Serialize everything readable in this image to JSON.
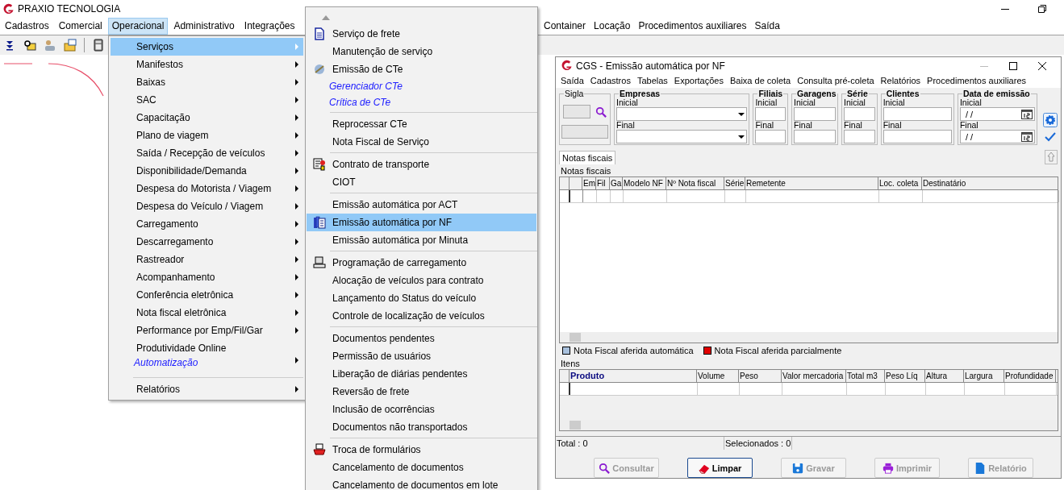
{
  "app": {
    "title": "PRAXIO TECNOLOGIA",
    "menubar": [
      {
        "label": "Cadastros",
        "selected": false
      },
      {
        "label": "Comercial",
        "selected": false
      },
      {
        "label": "Operacional",
        "selected": true
      },
      {
        "label": "Administrativo",
        "selected": false
      },
      {
        "label": "Integrações",
        "selected": false
      }
    ],
    "menubar_right": [
      "Container",
      "Locação",
      "Procedimentos auxiliares",
      "Saída"
    ]
  },
  "operacional_menu": [
    {
      "label": "Serviços",
      "kind": "item",
      "submenu": true,
      "selected": true
    },
    {
      "label": "Manifestos",
      "kind": "item",
      "submenu": true,
      "selected": false
    },
    {
      "label": "Baixas",
      "kind": "item",
      "submenu": true,
      "selected": false
    },
    {
      "label": "SAC",
      "kind": "item",
      "submenu": true,
      "selected": false
    },
    {
      "label": "Capacitação",
      "kind": "item",
      "submenu": true,
      "selected": false
    },
    {
      "label": "Plano de viagem",
      "kind": "item",
      "submenu": true,
      "selected": false
    },
    {
      "label": "Saída / Recepção de veículos",
      "kind": "item",
      "submenu": true,
      "selected": false
    },
    {
      "label": "Disponibilidade/Demanda",
      "kind": "item",
      "submenu": true,
      "selected": false
    },
    {
      "label": "Despesa do Motorista / Viagem",
      "kind": "item",
      "submenu": true,
      "selected": false
    },
    {
      "label": "Despesa do Veículo / Viagem",
      "kind": "item",
      "submenu": true,
      "selected": false
    },
    {
      "label": "Carregamento",
      "kind": "item",
      "submenu": true,
      "selected": false
    },
    {
      "label": "Descarregamento",
      "kind": "item",
      "submenu": true,
      "selected": false
    },
    {
      "label": "Rastreador",
      "kind": "item",
      "submenu": true,
      "selected": false
    },
    {
      "label": "Acompanhamento",
      "kind": "item",
      "submenu": true,
      "selected": false
    },
    {
      "label": "Conferência eletrônica",
      "kind": "item",
      "submenu": true,
      "selected": false
    },
    {
      "label": "Nota fiscal eletrônica",
      "kind": "item",
      "submenu": true,
      "selected": false
    },
    {
      "label": "Performance por Emp/Fil/Gar",
      "kind": "item",
      "submenu": true,
      "selected": false
    },
    {
      "label": "Produtividade Online",
      "kind": "item",
      "submenu": false,
      "selected": false
    },
    {
      "label": "Automatização",
      "kind": "link",
      "submenu": true,
      "selected": false
    },
    {
      "kind": "separator"
    },
    {
      "label": "Relatórios",
      "kind": "item",
      "submenu": true,
      "selected": false
    }
  ],
  "servicos_menu": [
    {
      "label": "Serviço de frete",
      "kind": "item",
      "selected": false
    },
    {
      "label": "Manutenção de serviço",
      "kind": "item",
      "selected": false
    },
    {
      "label": "Emissão de CTe",
      "kind": "item",
      "selected": false
    },
    {
      "label": "Gerenciador CTe",
      "kind": "link",
      "selected": false
    },
    {
      "label": "Crítica de CTe",
      "kind": "link",
      "selected": false
    },
    {
      "kind": "separator"
    },
    {
      "label": "Reprocessar CTe",
      "kind": "item",
      "selected": false
    },
    {
      "label": "Nota Fiscal de Serviço",
      "kind": "item",
      "selected": false
    },
    {
      "kind": "separator"
    },
    {
      "label": "Contrato de transporte",
      "kind": "item",
      "selected": false
    },
    {
      "label": "CIOT",
      "kind": "item",
      "selected": false
    },
    {
      "kind": "separator"
    },
    {
      "label": "Emissão automática por ACT",
      "kind": "item",
      "selected": false
    },
    {
      "label": "Emissão automática por NF",
      "kind": "item",
      "selected": true
    },
    {
      "label": "Emissão automática por Minuta",
      "kind": "item",
      "selected": false
    },
    {
      "kind": "separator"
    },
    {
      "label": "Programação de carregamento",
      "kind": "item",
      "selected": false
    },
    {
      "label": "Alocação de veículos para contrato",
      "kind": "item",
      "selected": false
    },
    {
      "label": "Lançamento do Status do veículo",
      "kind": "item",
      "selected": false
    },
    {
      "label": "Controle de localização de veículos",
      "kind": "item",
      "selected": false
    },
    {
      "kind": "separator"
    },
    {
      "label": "Documentos pendentes",
      "kind": "item",
      "selected": false
    },
    {
      "label": "Permissão de usuários",
      "kind": "item",
      "selected": false
    },
    {
      "label": "Liberação de diárias pendentes",
      "kind": "item",
      "selected": false
    },
    {
      "label": "Reversão de frete",
      "kind": "item",
      "selected": false
    },
    {
      "label": "Inclusão de ocorrências",
      "kind": "item",
      "selected": false
    },
    {
      "label": "Documentos não transportados",
      "kind": "item",
      "selected": false
    },
    {
      "kind": "separator"
    },
    {
      "label": "Troca de formulários",
      "kind": "item",
      "selected": false
    },
    {
      "label": "Cancelamento de documentos",
      "kind": "item",
      "selected": false
    },
    {
      "label": "Cancelamento de documentos em lote",
      "kind": "item",
      "selected": false
    }
  ],
  "cgs_window": {
    "title": "CGS - Emissão automática por NF",
    "menubar": [
      "Saída",
      "Cadastros",
      "Tabelas",
      "Exportações",
      "Baixa de coleta",
      "Consulta pré-coleta",
      "Relatórios",
      "Procedimentos auxiliares"
    ],
    "filters": [
      {
        "title": "Sigla",
        "fields": [
          {
            "kind": "search"
          },
          {
            "kind": "text"
          }
        ]
      },
      {
        "title": "Empresas",
        "fields": [
          {
            "label": "Inicial",
            "kind": "combo"
          },
          {
            "label": "Final",
            "kind": "combo"
          }
        ]
      },
      {
        "title": "Filiais",
        "fields": [
          {
            "label": "Inicial",
            "kind": "text"
          },
          {
            "label": "Final",
            "kind": "text"
          }
        ]
      },
      {
        "title": "Garagens",
        "fields": [
          {
            "label": "Inicial",
            "kind": "text"
          },
          {
            "label": "Final",
            "kind": "text"
          }
        ]
      },
      {
        "title": "Série",
        "fields": [
          {
            "label": "Inicial",
            "kind": "text"
          },
          {
            "label": "Final",
            "kind": "text"
          }
        ]
      },
      {
        "title": "Clientes",
        "fields": [
          {
            "label": "Inicial",
            "kind": "text"
          },
          {
            "label": "Final",
            "kind": "text"
          }
        ]
      },
      {
        "title": "Data de emissão",
        "fields": [
          {
            "label": "Inicial",
            "kind": "date",
            "value": "/ /"
          },
          {
            "label": "Final",
            "kind": "date",
            "value": "/ /"
          }
        ]
      }
    ],
    "tabs": [
      {
        "label": "Notas fiscais",
        "selected": true
      }
    ],
    "notas_label": "Notas fiscais",
    "notas_columns": [
      "Em",
      "Fil",
      "Ga",
      "Modelo NF",
      "Nº Nota fiscal",
      "Série",
      "Remetente",
      "Loc. coleta",
      "Destinatário"
    ],
    "legend": [
      {
        "label": "Nota Fiscal aferida automática",
        "color": "#a8c0dc"
      },
      {
        "label": "Nota Fiscal aferida parcialmente",
        "color": "#e00000"
      }
    ],
    "itens_label": "Itens",
    "itens_columns": [
      "Produto",
      "Volume",
      "Peso",
      "Valor mercadoria",
      "Total m3",
      "Peso Líq",
      "Altura",
      "Largura",
      "Profundidade"
    ],
    "status": [
      "Total : 0",
      "Selecionados : 0"
    ],
    "buttons": [
      {
        "label": "Consultar",
        "kind": "search",
        "disabled": true
      },
      {
        "label": "Limpar",
        "kind": "eraser",
        "disabled": false
      },
      {
        "label": "Gravar",
        "kind": "save",
        "disabled": true
      },
      {
        "label": "Imprimir",
        "kind": "print",
        "disabled": true
      },
      {
        "label": "Relatório",
        "kind": "report",
        "disabled": true
      }
    ]
  }
}
